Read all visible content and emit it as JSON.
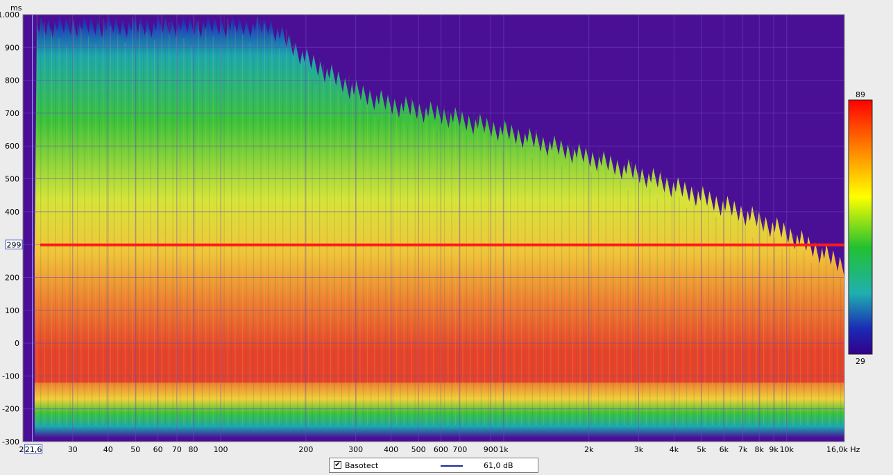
{
  "chart_data": {
    "type": "heatmap",
    "title": "",
    "xlabel": "Hz",
    "ylabel": "ms",
    "x_scale": "log",
    "xlim": [
      20,
      16000
    ],
    "ylim": [
      -300,
      1000
    ],
    "x_ticks": [
      {
        "v": 20,
        "label": "2"
      },
      {
        "v": 30,
        "label": "30"
      },
      {
        "v": 40,
        "label": "40"
      },
      {
        "v": 50,
        "label": "50"
      },
      {
        "v": 60,
        "label": "60"
      },
      {
        "v": 70,
        "label": "70"
      },
      {
        "v": 80,
        "label": "80"
      },
      {
        "v": 100,
        "label": "100"
      },
      {
        "v": 200,
        "label": "200"
      },
      {
        "v": 300,
        "label": "300"
      },
      {
        "v": 400,
        "label": "400"
      },
      {
        "v": 500,
        "label": "500"
      },
      {
        "v": 600,
        "label": "600"
      },
      {
        "v": 700,
        "label": "700"
      },
      {
        "v": 900,
        "label": "900"
      },
      {
        "v": 1000,
        "label": "1k"
      },
      {
        "v": 2000,
        "label": "2k"
      },
      {
        "v": 3000,
        "label": "3k"
      },
      {
        "v": 4000,
        "label": "4k"
      },
      {
        "v": 5000,
        "label": "5k"
      },
      {
        "v": 6000,
        "label": "6k"
      },
      {
        "v": 7000,
        "label": "7k"
      },
      {
        "v": 8000,
        "label": "8k"
      },
      {
        "v": 9000,
        "label": "9k"
      },
      {
        "v": 10000,
        "label": "10k"
      },
      {
        "v": 16000,
        "label": "16,0k Hz"
      }
    ],
    "y_ticks": [
      {
        "v": 1000,
        "label": "1.000"
      },
      {
        "v": 900,
        "label": "900"
      },
      {
        "v": 800,
        "label": "800"
      },
      {
        "v": 700,
        "label": "700"
      },
      {
        "v": 600,
        "label": "600"
      },
      {
        "v": 500,
        "label": "500"
      },
      {
        "v": 400,
        "label": "400"
      },
      {
        "v": 300,
        "label": ""
      },
      {
        "v": 200,
        "label": "200"
      },
      {
        "v": 100,
        "label": "100"
      },
      {
        "v": 0,
        "label": "0"
      },
      {
        "v": -100,
        "label": "-100"
      },
      {
        "v": -200,
        "label": "-200"
      },
      {
        "v": -300,
        "label": "-300"
      }
    ],
    "cursor": {
      "x": 21.6,
      "x_label": "21,6",
      "y": 299,
      "y_label": "299"
    },
    "colorbar": {
      "max": 89,
      "min": 29,
      "max_label": "89",
      "min_label": "29"
    },
    "red_line_ms": 299,
    "decay_envelope": [
      {
        "hz": 22,
        "ms": 1000
      },
      {
        "hz": 50,
        "ms": 1000
      },
      {
        "hz": 100,
        "ms": 1000
      },
      {
        "hz": 150,
        "ms": 1000
      },
      {
        "hz": 200,
        "ms": 900
      },
      {
        "hz": 300,
        "ms": 800
      },
      {
        "hz": 400,
        "ms": 760
      },
      {
        "hz": 600,
        "ms": 730
      },
      {
        "hz": 1000,
        "ms": 680
      },
      {
        "hz": 2000,
        "ms": 600
      },
      {
        "hz": 3000,
        "ms": 550
      },
      {
        "hz": 5000,
        "ms": 480
      },
      {
        "hz": 7000,
        "ms": 430
      },
      {
        "hz": 10000,
        "ms": 370
      },
      {
        "hz": 16000,
        "ms": 270
      }
    ],
    "hot_region": {
      "ms_top": 200,
      "ms_bottom": -120
    },
    "onset_ms": -250
  },
  "legend": {
    "checked": true,
    "check_mark": "✔",
    "name": "Basotect",
    "level": "61,0 dB",
    "line_color": "#1a2a9a"
  },
  "colors": {
    "background_purple": "#4b0f96",
    "red_line": "#ff1a1a",
    "cursor_line": "#9db3ff",
    "grid": "#6b48c0"
  }
}
